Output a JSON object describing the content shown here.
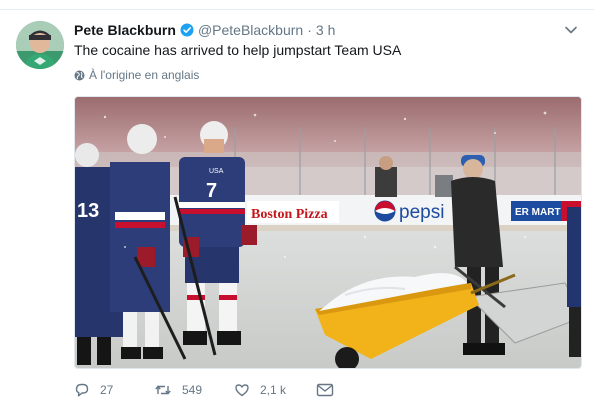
{
  "tweet": {
    "name": "Pete Blackburn",
    "handle": "@PeteBlackburn",
    "separator": "·",
    "time": "3 h",
    "text": "The cocaine has arrived to help jumpstart Team USA",
    "translate_label": "À l'origine en anglais"
  },
  "media": {
    "jersey_label": "USA",
    "jersey_number": "7",
    "jersey_number_left": "13",
    "board_ad_1": "Boston Pizza",
    "board_ad_2": "pepsi",
    "board_ad_3": "ER MART"
  },
  "actions": {
    "reply_count": "27",
    "retweet_count": "549",
    "like_count": "2,1 k"
  },
  "colors": {
    "accent": "#1da1f2",
    "secondary_text": "#657786",
    "primary_text": "#14171a",
    "jersey_blue": "#23356e",
    "shovel_yellow": "#f2b31a"
  }
}
